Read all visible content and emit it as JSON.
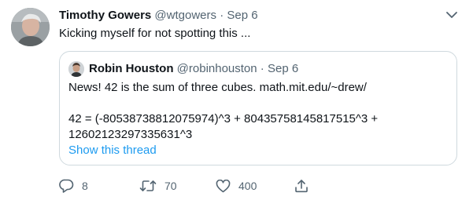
{
  "tweet": {
    "author_name": "Timothy Gowers",
    "author_handle": "@wtgowers",
    "separator": "·",
    "date": "Sep 6",
    "text": "Kicking myself for not spotting this ...",
    "avatar_icon": "profile-photo",
    "menu_icon": "chevron-down-icon"
  },
  "quote": {
    "author_name": "Robin Houston",
    "author_handle": "@robinhouston",
    "separator": "·",
    "date": "Sep 6",
    "line1_prefix": "News! 42 is the sum of three cubes. ",
    "line1_link": "math.mit.edu/~drew/",
    "line2": "42 = (-80538738812075974)^3 + 80435758145817515^3 +",
    "line3": "12602123297335631^3",
    "show_thread": "Show this thread"
  },
  "actions": {
    "reply_count": "8",
    "retweet_count": "70",
    "like_count": "400",
    "reply_icon": "reply-icon",
    "retweet_icon": "retweet-icon",
    "like_icon": "heart-icon",
    "share_icon": "share-icon"
  },
  "colors": {
    "text": "#0f1419",
    "secondary": "#536471",
    "link": "#1d9bf0",
    "border": "#cfd9de"
  }
}
